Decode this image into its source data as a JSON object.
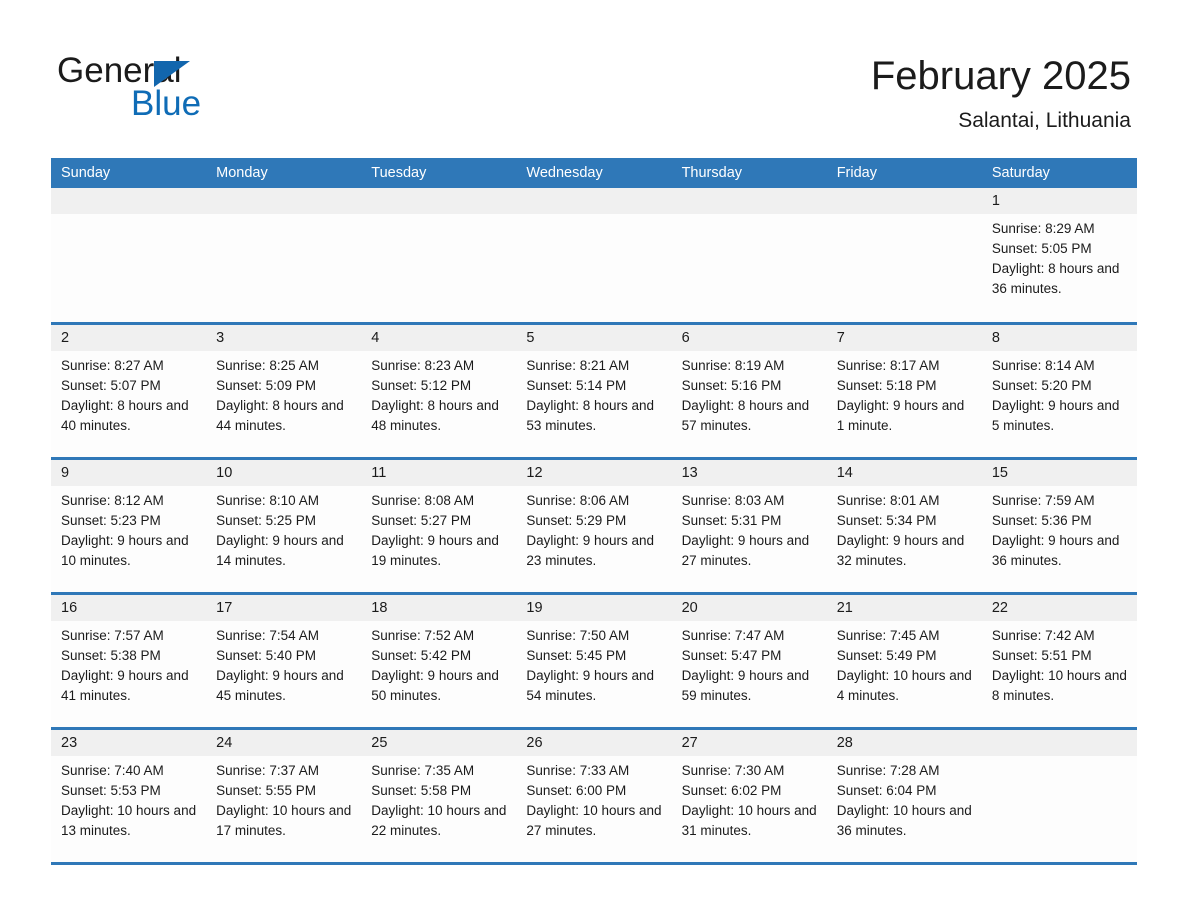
{
  "brand": {
    "name_part1": "General",
    "name_part2": "Blue",
    "accent_color": "#2f78b8",
    "logo_blue": "#0f6cb6"
  },
  "header": {
    "title": "February 2025",
    "subtitle": "Salantai, Lithuania"
  },
  "calendar": {
    "weekday_headers": [
      "Sunday",
      "Monday",
      "Tuesday",
      "Wednesday",
      "Thursday",
      "Friday",
      "Saturday"
    ],
    "header_bg": "#2f78b8",
    "daynum_bg": "#f0f0f0",
    "weeks": [
      [
        {
          "day": "",
          "lines": []
        },
        {
          "day": "",
          "lines": []
        },
        {
          "day": "",
          "lines": []
        },
        {
          "day": "",
          "lines": []
        },
        {
          "day": "",
          "lines": []
        },
        {
          "day": "",
          "lines": []
        },
        {
          "day": "1",
          "lines": [
            "Sunrise: 8:29 AM",
            "Sunset: 5:05 PM",
            "Daylight: 8 hours and 36 minutes."
          ]
        }
      ],
      [
        {
          "day": "2",
          "lines": [
            "Sunrise: 8:27 AM",
            "Sunset: 5:07 PM",
            "Daylight: 8 hours and 40 minutes."
          ]
        },
        {
          "day": "3",
          "lines": [
            "Sunrise: 8:25 AM",
            "Sunset: 5:09 PM",
            "Daylight: 8 hours and 44 minutes."
          ]
        },
        {
          "day": "4",
          "lines": [
            "Sunrise: 8:23 AM",
            "Sunset: 5:12 PM",
            "Daylight: 8 hours and 48 minutes."
          ]
        },
        {
          "day": "5",
          "lines": [
            "Sunrise: 8:21 AM",
            "Sunset: 5:14 PM",
            "Daylight: 8 hours and 53 minutes."
          ]
        },
        {
          "day": "6",
          "lines": [
            "Sunrise: 8:19 AM",
            "Sunset: 5:16 PM",
            "Daylight: 8 hours and 57 minutes."
          ]
        },
        {
          "day": "7",
          "lines": [
            "Sunrise: 8:17 AM",
            "Sunset: 5:18 PM",
            "Daylight: 9 hours and 1 minute."
          ]
        },
        {
          "day": "8",
          "lines": [
            "Sunrise: 8:14 AM",
            "Sunset: 5:20 PM",
            "Daylight: 9 hours and 5 minutes."
          ]
        }
      ],
      [
        {
          "day": "9",
          "lines": [
            "Sunrise: 8:12 AM",
            "Sunset: 5:23 PM",
            "Daylight: 9 hours and 10 minutes."
          ]
        },
        {
          "day": "10",
          "lines": [
            "Sunrise: 8:10 AM",
            "Sunset: 5:25 PM",
            "Daylight: 9 hours and 14 minutes."
          ]
        },
        {
          "day": "11",
          "lines": [
            "Sunrise: 8:08 AM",
            "Sunset: 5:27 PM",
            "Daylight: 9 hours and 19 minutes."
          ]
        },
        {
          "day": "12",
          "lines": [
            "Sunrise: 8:06 AM",
            "Sunset: 5:29 PM",
            "Daylight: 9 hours and 23 minutes."
          ]
        },
        {
          "day": "13",
          "lines": [
            "Sunrise: 8:03 AM",
            "Sunset: 5:31 PM",
            "Daylight: 9 hours and 27 minutes."
          ]
        },
        {
          "day": "14",
          "lines": [
            "Sunrise: 8:01 AM",
            "Sunset: 5:34 PM",
            "Daylight: 9 hours and 32 minutes."
          ]
        },
        {
          "day": "15",
          "lines": [
            "Sunrise: 7:59 AM",
            "Sunset: 5:36 PM",
            "Daylight: 9 hours and 36 minutes."
          ]
        }
      ],
      [
        {
          "day": "16",
          "lines": [
            "Sunrise: 7:57 AM",
            "Sunset: 5:38 PM",
            "Daylight: 9 hours and 41 minutes."
          ]
        },
        {
          "day": "17",
          "lines": [
            "Sunrise: 7:54 AM",
            "Sunset: 5:40 PM",
            "Daylight: 9 hours and 45 minutes."
          ]
        },
        {
          "day": "18",
          "lines": [
            "Sunrise: 7:52 AM",
            "Sunset: 5:42 PM",
            "Daylight: 9 hours and 50 minutes."
          ]
        },
        {
          "day": "19",
          "lines": [
            "Sunrise: 7:50 AM",
            "Sunset: 5:45 PM",
            "Daylight: 9 hours and 54 minutes."
          ]
        },
        {
          "day": "20",
          "lines": [
            "Sunrise: 7:47 AM",
            "Sunset: 5:47 PM",
            "Daylight: 9 hours and 59 minutes."
          ]
        },
        {
          "day": "21",
          "lines": [
            "Sunrise: 7:45 AM",
            "Sunset: 5:49 PM",
            "Daylight: 10 hours and 4 minutes."
          ]
        },
        {
          "day": "22",
          "lines": [
            "Sunrise: 7:42 AM",
            "Sunset: 5:51 PM",
            "Daylight: 10 hours and 8 minutes."
          ]
        }
      ],
      [
        {
          "day": "23",
          "lines": [
            "Sunrise: 7:40 AM",
            "Sunset: 5:53 PM",
            "Daylight: 10 hours and 13 minutes."
          ]
        },
        {
          "day": "24",
          "lines": [
            "Sunrise: 7:37 AM",
            "Sunset: 5:55 PM",
            "Daylight: 10 hours and 17 minutes."
          ]
        },
        {
          "day": "25",
          "lines": [
            "Sunrise: 7:35 AM",
            "Sunset: 5:58 PM",
            "Daylight: 10 hours and 22 minutes."
          ]
        },
        {
          "day": "26",
          "lines": [
            "Sunrise: 7:33 AM",
            "Sunset: 6:00 PM",
            "Daylight: 10 hours and 27 minutes."
          ]
        },
        {
          "day": "27",
          "lines": [
            "Sunrise: 7:30 AM",
            "Sunset: 6:02 PM",
            "Daylight: 10 hours and 31 minutes."
          ]
        },
        {
          "day": "28",
          "lines": [
            "Sunrise: 7:28 AM",
            "Sunset: 6:04 PM",
            "Daylight: 10 hours and 36 minutes."
          ]
        },
        {
          "day": "",
          "lines": []
        }
      ]
    ]
  }
}
